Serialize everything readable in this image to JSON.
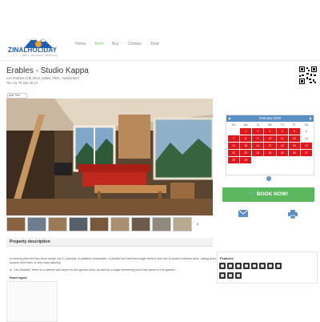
{
  "header": {
    "logo_text": "ZINALHOLIDAY",
    "logo_tagline": "RENT · VACATION · SERVICES",
    "nav": [
      {
        "label": "Home",
        "active": false
      },
      {
        "label": "Rent",
        "active": true
      },
      {
        "label": "Buy",
        "active": false
      },
      {
        "label": "Contact",
        "active": false
      },
      {
        "label": "Zinal",
        "active": false
      }
    ]
  },
  "property": {
    "title": "Erables - Studio Kappa",
    "address": "Les Erables (C5) Zinal, Valais, 3961, Switzerland",
    "phone": "Tel.+41 79 204 36 17"
  },
  "share": {
    "label": "Add This",
    "extra": "· · ·"
  },
  "gallery": {
    "prev_icon": "chevron-left-icon",
    "next_icon": "chevron-right-icon",
    "thumbnail_count": 9
  },
  "calendar": {
    "month_label": "February 2016",
    "weekdays": [
      "Su",
      "Mo",
      "Tu",
      "We",
      "Th",
      "Fr",
      "Sa"
    ],
    "leading_blanks": 1,
    "days": [
      {
        "d": "1",
        "booked": true
      },
      {
        "d": "2",
        "booked": true
      },
      {
        "d": "3",
        "booked": true
      },
      {
        "d": "4",
        "booked": true
      },
      {
        "d": "5",
        "booked": true
      },
      {
        "d": "6",
        "booked": false
      },
      {
        "d": "7",
        "booked": true
      },
      {
        "d": "8",
        "booked": true
      },
      {
        "d": "9",
        "booked": true
      },
      {
        "d": "10",
        "booked": true
      },
      {
        "d": "11",
        "booked": true
      },
      {
        "d": "12",
        "booked": true
      },
      {
        "d": "13",
        "booked": false
      },
      {
        "d": "14",
        "booked": true
      },
      {
        "d": "15",
        "booked": true
      },
      {
        "d": "16",
        "booked": true
      },
      {
        "d": "17",
        "booked": true
      },
      {
        "d": "18",
        "booked": true
      },
      {
        "d": "19",
        "booked": true
      },
      {
        "d": "20",
        "booked": true
      },
      {
        "d": "21",
        "booked": true
      },
      {
        "d": "22",
        "booked": true
      },
      {
        "d": "23",
        "booked": true
      },
      {
        "d": "24",
        "booked": true
      },
      {
        "d": "25",
        "booked": true
      },
      {
        "d": "26",
        "booked": true
      },
      {
        "d": "27",
        "booked": true
      },
      {
        "d": "28",
        "booked": true
      },
      {
        "d": "29",
        "booked": true
      }
    ],
    "booked_color": "#e3161c",
    "info_icon": "info-icon"
  },
  "actions": {
    "book_label": "BOOK NOW!",
    "book_color": "#5cb85c",
    "contact_icon": "envelope-icon",
    "print_icon": "printer-icon"
  },
  "description": {
    "section_title": "Property description",
    "paragraph1": "A cleverly planned two-level studio, for 2-4 people. A sofabed downstairs, a double bed and two single beds in the loft. A modern kitchen area, eating area, shower and toilet. A very long balcony.",
    "paragraph2": "In \"Les Erables\" there is a washer and dryer on the ground floor, as well as a large swimming pool that opens to the garden.",
    "room_types_label": "Room types"
  },
  "features": {
    "title": "Features",
    "icons": [
      "tv-icon",
      "wifi-icon",
      "kitchen-icon",
      "bath-icon",
      "parking-icon",
      "balcony-icon",
      "pool-icon",
      "washer-icon",
      "dryer-icon",
      "elevator-icon",
      "no-smoking-icon"
    ]
  }
}
